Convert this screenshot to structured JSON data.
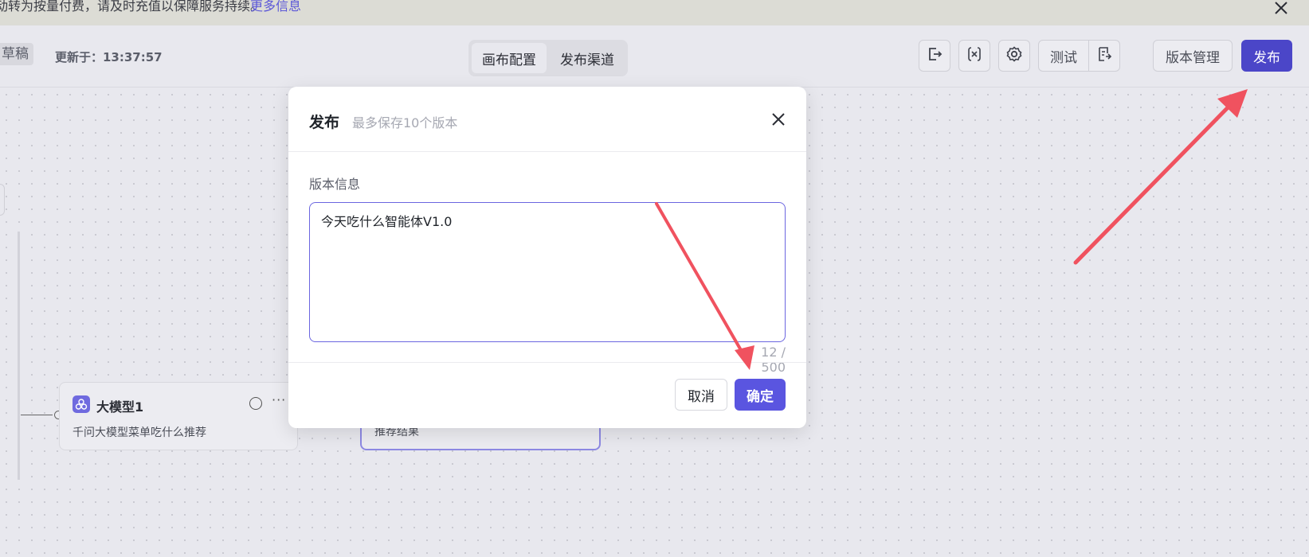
{
  "notice": {
    "text": "动转为按量付费，请及时充值以保障服务持续。",
    "more_link": "更多信息"
  },
  "toolbar": {
    "draft_tag": "草稿",
    "updated_label": "更新于：13:37:57",
    "tabs": [
      {
        "label": "画布配置",
        "active": true
      },
      {
        "label": "发布渠道",
        "active": false
      }
    ],
    "test_label": "测试",
    "version_manage_label": "版本管理",
    "publish_label": "发布"
  },
  "canvas": {
    "node1": {
      "title": "大模型1",
      "desc": "千问大模型菜单吃什么推荐",
      "menu": "···"
    },
    "node2": {
      "desc": "推荐结果"
    }
  },
  "modal": {
    "title": "发布",
    "subtitle": "最多保存10个版本",
    "field_label": "版本信息",
    "textarea_value": "今天吃什么智能体V1.0",
    "counter": "12 / 500",
    "cancel_label": "取消",
    "ok_label": "确定"
  },
  "colors": {
    "accent": "#5a55e0",
    "annotation_arrow": "#f0525f"
  },
  "icons": [
    "close-icon",
    "export-icon",
    "variable-icon",
    "gear-icon",
    "doc-icon",
    "model-icon",
    "play-icon"
  ]
}
